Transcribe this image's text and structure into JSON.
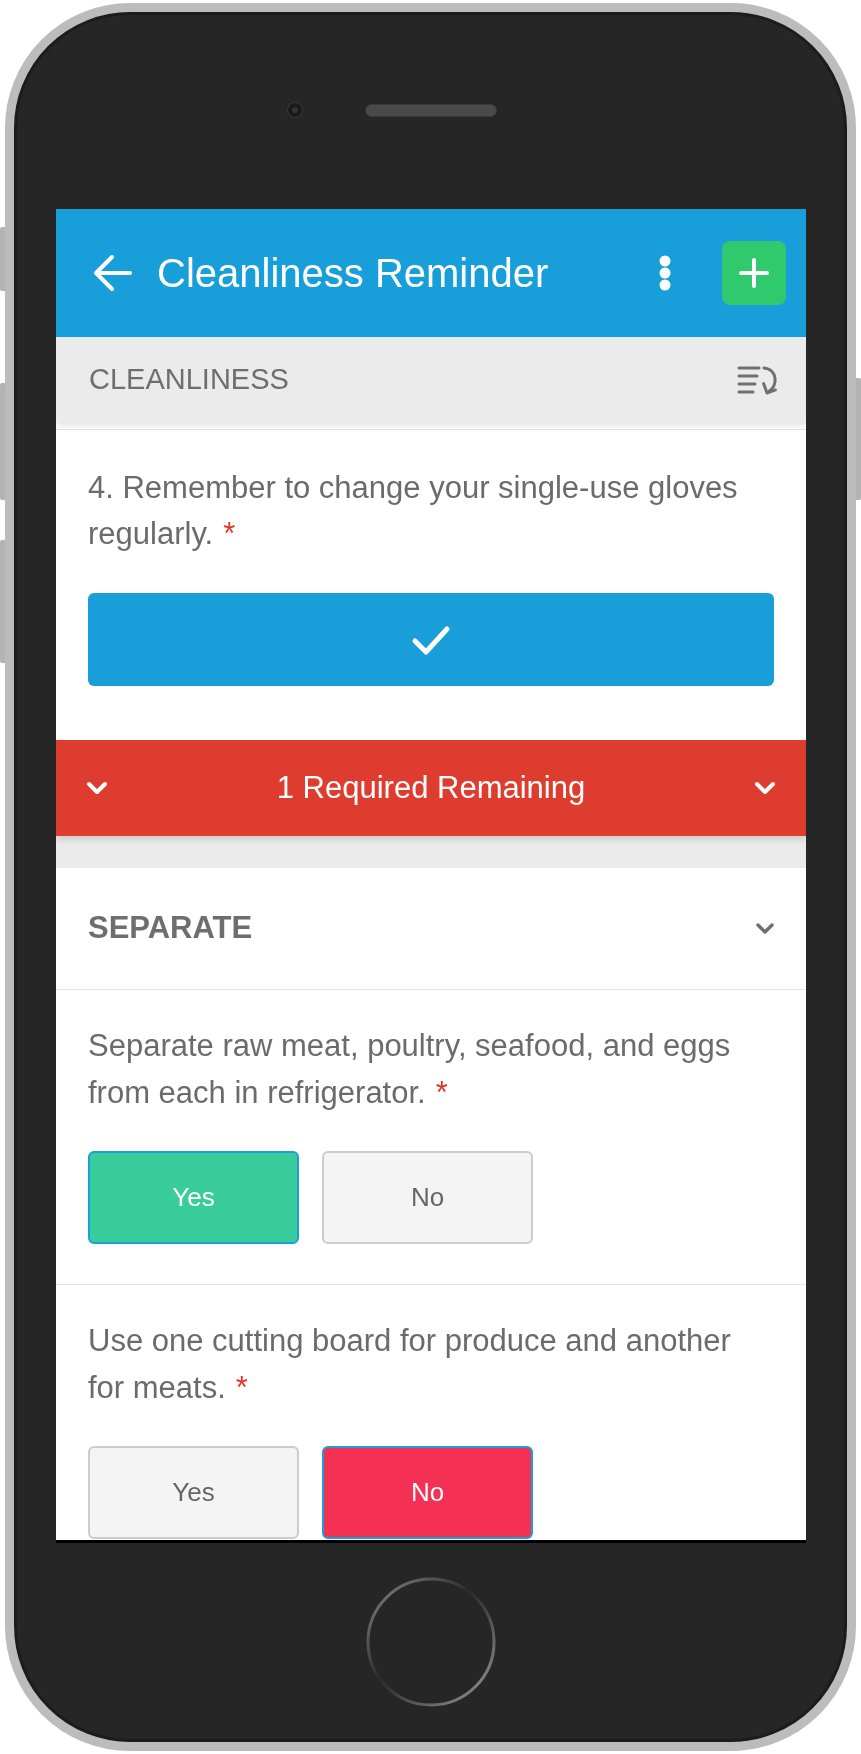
{
  "header": {
    "title": "Cleanliness Reminder"
  },
  "section_bar": {
    "title": "CLEANLINESS"
  },
  "questions": [
    {
      "kind": "check",
      "text": "4. Remember to change your single-use gloves regularly.",
      "required_mark": "*",
      "checked": true
    }
  ],
  "required_banner": {
    "text": "1 Required Remaining"
  },
  "sections": [
    {
      "title": "SEPARATE",
      "questions": [
        {
          "kind": "yes_no",
          "text": "Separate raw meat, poultry, seafood, and eggs from each in refrigerator.",
          "required_mark": "*",
          "options": [
            {
              "label": "Yes",
              "selected": true
            },
            {
              "label": "No",
              "selected": false
            }
          ]
        },
        {
          "kind": "yes_no",
          "text": "Use one cutting board for produce and another for meats.",
          "required_mark": "*",
          "options": [
            {
              "label": "Yes",
              "selected": false
            },
            {
              "label": "No",
              "selected": true
            }
          ]
        }
      ]
    }
  ]
}
